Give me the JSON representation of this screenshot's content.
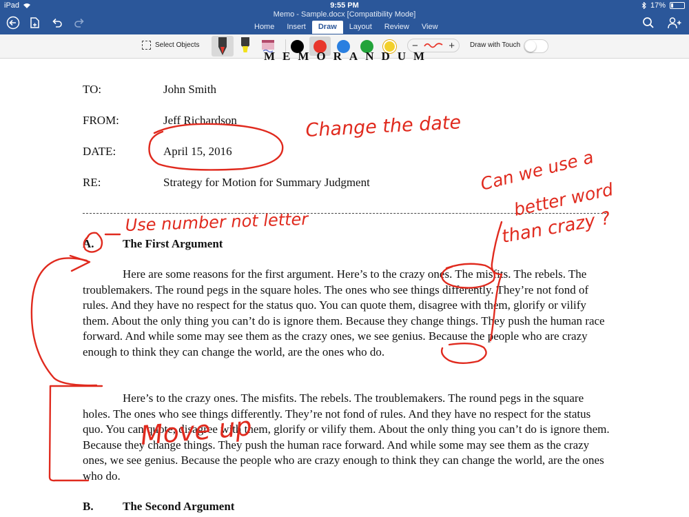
{
  "status_bar": {
    "device": "iPad",
    "time": "9:55 PM",
    "battery": "17%",
    "battery_level": 0.17
  },
  "app": {
    "document_title": "Memo - Sample.docx [Compatibility Mode]"
  },
  "tabs": [
    {
      "label": "Home"
    },
    {
      "label": "Insert"
    },
    {
      "label": "Draw",
      "active": true
    },
    {
      "label": "Layout"
    },
    {
      "label": "Review"
    },
    {
      "label": "View"
    }
  ],
  "ribbon": {
    "select_objects_label": "Select Objects",
    "pens": [
      "pen-red",
      "highlighter-yellow",
      "pencil-gradient"
    ],
    "colors": [
      "#000000",
      "#e8362b",
      "#2a7fe0",
      "#22a33a",
      "#f2d02b"
    ],
    "selected_color": "#e8362b",
    "thickness_minus": "−",
    "thickness_plus": "+",
    "draw_with_touch_label": "Draw with Touch",
    "draw_with_touch_on": false
  },
  "icons": {
    "back": "back-circle-icon",
    "save": "file-save-icon",
    "undo": "undo-icon",
    "redo": "redo-icon",
    "search": "search-icon",
    "share": "add-person-icon"
  },
  "memo": {
    "heading": "MEMORANDUM",
    "to_label": "TO:",
    "to_value": "John Smith",
    "from_label": "FROM:",
    "from_value": "Jeff Richardson",
    "date_label": "DATE:",
    "date_value": "April 15, 2016",
    "re_label": "RE:",
    "re_value": "Strategy for Motion for Summary Judgment",
    "section_a_num": "A.",
    "section_a_title": "The First Argument",
    "para1": "Here are some reasons for the first argument.  Here’s to the crazy ones. The misfits. The rebels. The troublemakers. The round pegs in the square holes. The ones who see things differently. They’re not fond of rules. And they have no respect for the status quo. You can quote them, disagree with them, glorify or vilify them. About the only thing you can’t do is ignore them. Because they change things. They push the human race forward. And while some may see them as the crazy ones, we see genius. Because the people who are crazy enough to think they can change the world, are the ones who do.",
    "para2": "Here’s to the crazy ones. The misfits. The rebels. The troublemakers. The round pegs in the square holes. The ones who see things differently. They’re not fond of rules. And they have no respect for the status quo. You can quote, disagree with them, glorify or vilify them. About the only thing you can’t do is ignore them. Because they change things. They push the human race forward. And while some may see them as the crazy ones, we see genius. Because the people who are crazy enough to think they can change the world, are the ones who do.",
    "section_b_num": "B.",
    "section_b_title": "The Second Argument"
  },
  "annotations": {
    "ink_color": "#e02a1e",
    "change_date": "Change the date",
    "use_number": "Use number not letter",
    "better_word_1": "Can we use a",
    "better_word_2": "better word",
    "better_word_3": "than crazy ?",
    "move_up": "Move up"
  }
}
